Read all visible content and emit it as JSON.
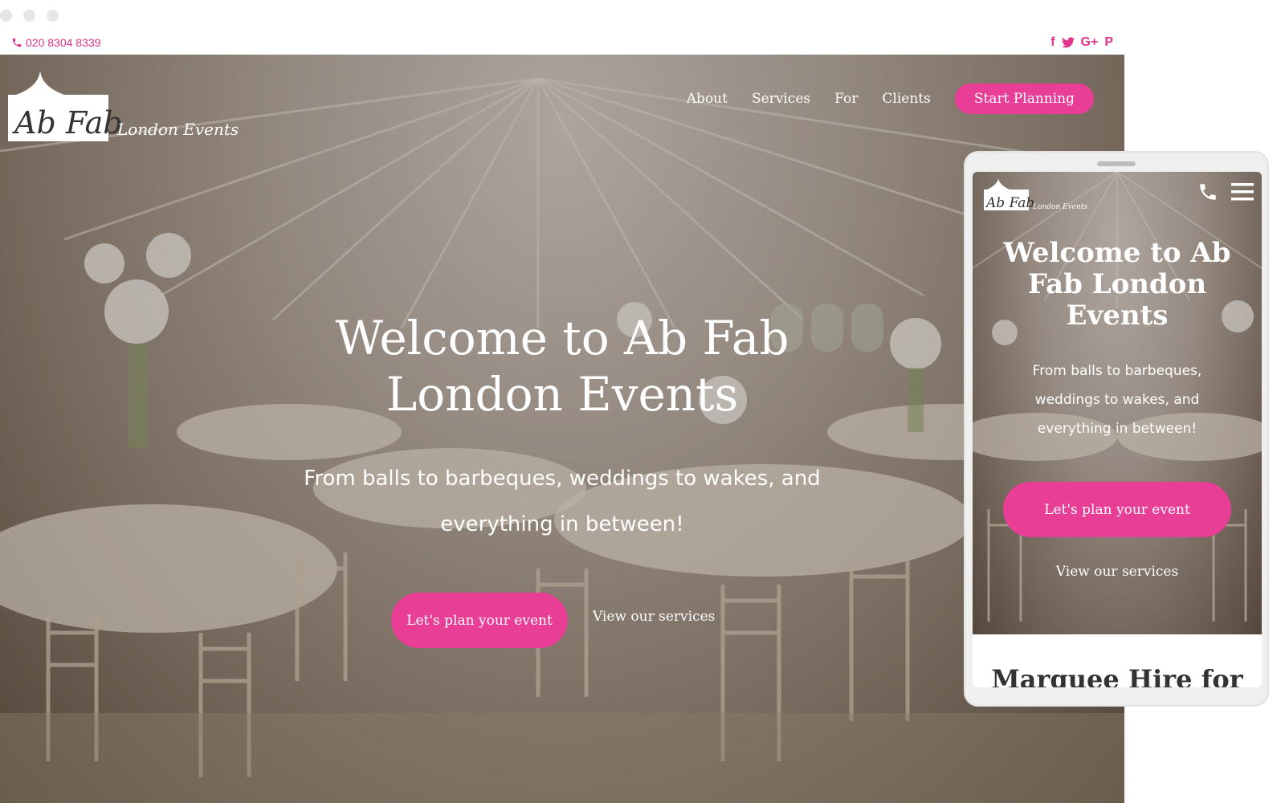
{
  "window": {
    "controls": [
      "close",
      "minimize",
      "maximize"
    ]
  },
  "topbar": {
    "phone": "020 8304 8339",
    "phone_icon": "phone-icon",
    "social": [
      {
        "icon": "facebook-icon",
        "glyph": "f"
      },
      {
        "icon": "twitter-icon",
        "glyph": "🐦"
      },
      {
        "icon": "google-plus-icon",
        "glyph": "G+"
      },
      {
        "icon": "pinterest-icon",
        "glyph": "P"
      }
    ]
  },
  "brand": {
    "logo_main": "Ab Fab",
    "logo_sub": "London Events"
  },
  "nav": {
    "items": [
      "About",
      "Services",
      "For",
      "Clients"
    ],
    "cta": "Start Planning"
  },
  "hero": {
    "title": "Welcome to Ab Fab London Events",
    "subtitle": "From balls to barbeques, weddings to wakes, and everything in between!",
    "primary_button": "Let's plan your event",
    "secondary_link": "View our services"
  },
  "mobile": {
    "title": "Welcome to Ab Fab London Events",
    "subtitle": "From balls to barbeques, weddings to wakes, and everything in between!",
    "primary_button": "Let's plan your event",
    "secondary_link": "View our services",
    "next_section_heading": "Marquee Hire for"
  },
  "colors": {
    "accent": "#e83e96",
    "topbar_text": "#e0348f"
  }
}
